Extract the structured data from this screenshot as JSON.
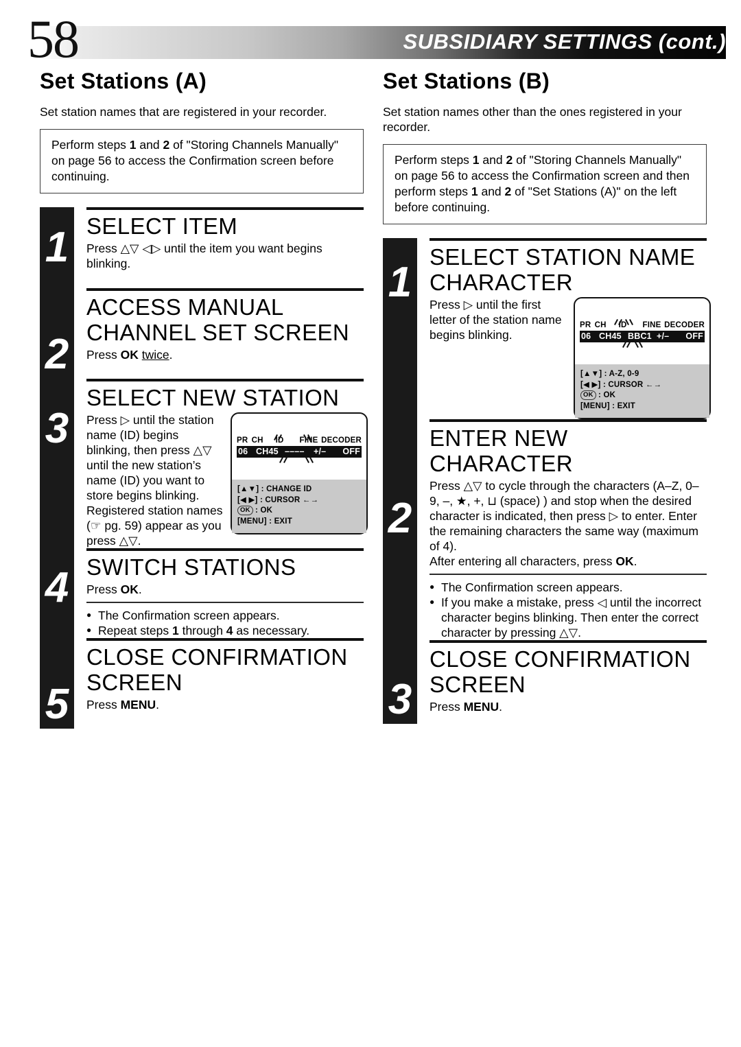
{
  "header": {
    "page_number": "58",
    "title": "SUBSIDIARY SETTINGS (cont.)"
  },
  "left_column": {
    "section_title": "Set Stations (A)",
    "intro": "Set station names that are registered in your recorder.",
    "prereq": "Perform steps 1 and 2 of \"Storing Channels Manually\" on page 56 to access the Confirmation screen before continuing.",
    "prereq_parts": {
      "a": "Perform steps ",
      "b1": "1",
      "c": " and ",
      "b2": "2",
      "d": " of \"Storing Channels Manually\" on page 56 to access the Confirmation screen before continuing."
    },
    "steps": [
      {
        "number": "1",
        "heading": "SELECT ITEM",
        "body": "Press △▽ ◁▷ until the item you want begins blinking."
      },
      {
        "number": "2",
        "heading": "ACCESS MANUAL CHANNEL SET SCREEN",
        "body_pre": "Press ",
        "body_bold": "OK",
        "body_underline": "twice",
        "body_post": "."
      },
      {
        "number": "3",
        "heading": "SELECT NEW STATION",
        "body": "Press ▷ until the station name (ID) begins blinking, then press △▽ until the new station’s name (ID) you want to store begins blinking.",
        "body2_pre": "Registered station names (",
        "body2_hand": "☞",
        "body2_mid": " pg. 59) appear as you press △▽.",
        "osd": {
          "headers": [
            "PR",
            "CH",
            "ID",
            "FINE",
            "DECODER"
          ],
          "values": [
            "06",
            "CH45",
            "––––",
            "+/–",
            "OFF"
          ],
          "legend": [
            {
              "key": "[▲▼]",
              "sep": " : ",
              "value": "CHANGE ID"
            },
            {
              "key": "[◀ ▶]",
              "sep": " : ",
              "value": "CURSOR ←→"
            },
            {
              "key": "OK",
              "sep": " : ",
              "value": "OK",
              "boxed": true
            },
            {
              "key": "[MENU]",
              "sep": " : ",
              "value": "EXIT"
            }
          ]
        }
      },
      {
        "number": "4",
        "heading": "SWITCH STATIONS",
        "body_pre": "Press ",
        "body_bold": "OK",
        "body_post": ".",
        "bullets": [
          "The Confirmation screen appears.",
          "Repeat steps 1 through 4 as necessary."
        ],
        "bullet2_parts": {
          "a": "Repeat steps ",
          "b1": "1",
          "c": " through ",
          "b2": "4",
          "d": " as necessary."
        }
      },
      {
        "number": "5",
        "heading": "CLOSE CONFIRMATION SCREEN",
        "body_pre": "Press ",
        "body_bold": "MENU",
        "body_post": "."
      }
    ]
  },
  "right_column": {
    "section_title": "Set Stations (B)",
    "intro": "Set station names other than the ones registered in your recorder.",
    "prereq_parts": {
      "a": "Perform steps ",
      "b1": "1",
      "c": " and ",
      "b2": "2",
      "d": " of \"Storing Channels Manually\" on page 56 to access the Confirmation screen and then perform steps ",
      "b3": "1",
      "e": " and ",
      "b4": "2",
      "f": " of \"Set Stations (A)\" on the left before continuing."
    },
    "steps": [
      {
        "number": "1",
        "heading": "SELECT STATION NAME CHARACTER",
        "body": "Press ▷ until the first letter of the station name begins blinking.",
        "osd": {
          "headers": [
            "PR",
            "CH",
            "ID",
            "FINE",
            "DECODER"
          ],
          "values": [
            "06",
            "CH45",
            "BBC1",
            "+/–",
            "OFF"
          ],
          "legend": [
            {
              "key": "[▲▼]",
              "sep": " : ",
              "value": "A-Z, 0-9"
            },
            {
              "key": "[◀ ▶]",
              "sep": " : ",
              "value": "CURSOR ←→"
            },
            {
              "key": "OK",
              "sep": " : ",
              "value": "OK",
              "boxed": true
            },
            {
              "key": "[MENU]",
              "sep": " : ",
              "value": "EXIT"
            }
          ]
        }
      },
      {
        "number": "2",
        "heading": "ENTER NEW CHARACTER",
        "body_a": "Press △▽ to cycle through the characters (A–Z, 0–9, –, ★, +, ⊔ (space) ) and stop when the desired character is indicated, then press ▷ to enter. Enter the remaining characters the same way (maximum of 4).",
        "body_b_pre": "After entering all characters, press ",
        "body_b_bold": "OK",
        "body_b_post": ".",
        "bullets": [
          "The Confirmation screen appears.",
          "If you make a mistake, press ◁ until the incorrect character begins blinking. Then enter the correct character by pressing △▽."
        ]
      },
      {
        "number": "3",
        "heading": "CLOSE CONFIRMATION SCREEN",
        "body_pre": "Press ",
        "body_bold": "MENU",
        "body_post": "."
      }
    ]
  },
  "colors": {
    "ink": "#111111",
    "bar_black": "#1a1a1a",
    "osd_legend_gray": "#c9c9c9"
  }
}
